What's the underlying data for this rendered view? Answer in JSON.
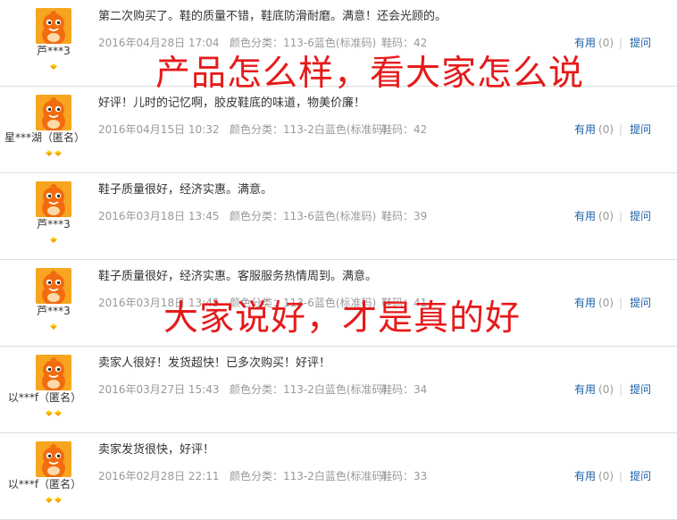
{
  "reviews": [
    {
      "user": "芦***3",
      "anonymous": false,
      "badge_count": 1,
      "content": "第二次购买了。鞋的质量不错，鞋底防滑耐磨。满意！还会光顾的。",
      "date": "2016年04月28日 17:04",
      "sku": "颜色分类：113-6蓝色(标准码)",
      "size": "鞋码：42",
      "useful_label": "有用",
      "useful_count": "(0)",
      "ask_label": "提问"
    },
    {
      "user": "星***湖（匿名）",
      "anonymous": true,
      "badge_count": 2,
      "content": "好评！儿时的记忆啊，胶皮鞋底的味道，物美价廉！",
      "date": "2016年04月15日 10:32",
      "sku": "颜色分类：113-2白蓝色(标准码)",
      "size": "鞋码：42",
      "useful_label": "有用",
      "useful_count": "(0)",
      "ask_label": "提问"
    },
    {
      "user": "芦***3",
      "anonymous": false,
      "badge_count": 1,
      "content": "鞋子质量很好，经济实惠。满意。",
      "date": "2016年03月18日 13:45",
      "sku": "颜色分类：113-6蓝色(标准码)",
      "size": "鞋码：39",
      "useful_label": "有用",
      "useful_count": "(0)",
      "ask_label": "提问"
    },
    {
      "user": "芦***3",
      "anonymous": false,
      "badge_count": 1,
      "content": "鞋子质量很好，经济实惠。客服服务热情周到。满意。",
      "date": "2016年03月18日 13:45",
      "sku": "颜色分类：113-6蓝色(标准码)",
      "size": "鞋码：41",
      "useful_label": "有用",
      "useful_count": "(0)",
      "ask_label": "提问"
    },
    {
      "user": "以***f（匿名）",
      "anonymous": true,
      "badge_count": 2,
      "content": "卖家人很好！发货超快！已多次购买！好评！",
      "date": "2016年03月27日 15:43",
      "sku": "颜色分类：113-2白蓝色(标准码)",
      "size": "鞋码：34",
      "useful_label": "有用",
      "useful_count": "(0)",
      "ask_label": "提问"
    },
    {
      "user": "以***f（匿名）",
      "anonymous": true,
      "badge_count": 2,
      "content": "卖家发货很快，好评！",
      "date": "2016年02月28日 22:11",
      "sku": "颜色分类：113-2白蓝色(标准码)",
      "size": "鞋码：33",
      "useful_label": "有用",
      "useful_count": "(0)",
      "ask_label": "提问"
    }
  ],
  "overlays": {
    "top": "产品怎么样，看大家怎么说",
    "middle": "大家说好，才是真的好"
  },
  "colors": {
    "overlay": "#e61a1a",
    "link": "#1a5fa8",
    "avatar": "#f7a51e"
  }
}
